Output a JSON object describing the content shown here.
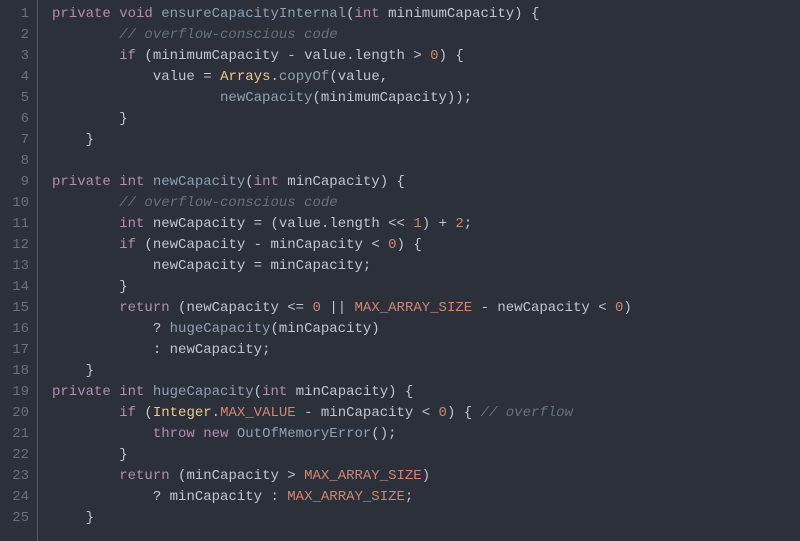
{
  "colors": {
    "background": "#2b303b",
    "gutter_border": "#4f5b66",
    "gutter_text": "#65737e",
    "default": "#c0c5ce",
    "keyword": "#b48ead",
    "function": "#8fa1b3",
    "number": "#d08770",
    "comment": "#65737e",
    "class": "#ebcb8b",
    "constant": "#d08770"
  },
  "lines": [
    {
      "num": "1",
      "tokens": [
        [
          "k",
          "private"
        ],
        [
          "p",
          " "
        ],
        [
          "t",
          "void"
        ],
        [
          "p",
          " "
        ],
        [
          "fn",
          "ensureCapacityInternal"
        ],
        [
          "p",
          "("
        ],
        [
          "t",
          "int"
        ],
        [
          "p",
          " "
        ],
        [
          "id",
          "minimumCapacity"
        ],
        [
          "p",
          ") {"
        ]
      ]
    },
    {
      "num": "2",
      "tokens": [
        [
          "p",
          "        "
        ],
        [
          "cm",
          "// overflow-conscious code"
        ]
      ]
    },
    {
      "num": "3",
      "tokens": [
        [
          "p",
          "        "
        ],
        [
          "k",
          "if"
        ],
        [
          "p",
          " ("
        ],
        [
          "id",
          "minimumCapacity"
        ],
        [
          "p",
          " "
        ],
        [
          "op",
          "-"
        ],
        [
          "p",
          " "
        ],
        [
          "id",
          "value"
        ],
        [
          "p",
          "."
        ],
        [
          "id",
          "length"
        ],
        [
          "p",
          " "
        ],
        [
          "op",
          ">"
        ],
        [
          "p",
          " "
        ],
        [
          "num",
          "0"
        ],
        [
          "p",
          ") {"
        ]
      ]
    },
    {
      "num": "4",
      "tokens": [
        [
          "p",
          "            "
        ],
        [
          "id",
          "value"
        ],
        [
          "p",
          " "
        ],
        [
          "op",
          "="
        ],
        [
          "p",
          " "
        ],
        [
          "cls",
          "Arrays"
        ],
        [
          "p",
          "."
        ],
        [
          "fn",
          "copyOf"
        ],
        [
          "p",
          "("
        ],
        [
          "id",
          "value"
        ],
        [
          "p",
          ","
        ]
      ]
    },
    {
      "num": "5",
      "tokens": [
        [
          "p",
          "                    "
        ],
        [
          "fn",
          "newCapacity"
        ],
        [
          "p",
          "("
        ],
        [
          "id",
          "minimumCapacity"
        ],
        [
          "p",
          "));"
        ]
      ]
    },
    {
      "num": "6",
      "tokens": [
        [
          "p",
          "        }"
        ]
      ]
    },
    {
      "num": "7",
      "tokens": [
        [
          "p",
          "    }"
        ]
      ]
    },
    {
      "num": "8",
      "tokens": [
        [
          "p",
          ""
        ]
      ]
    },
    {
      "num": "9",
      "tokens": [
        [
          "k",
          "private"
        ],
        [
          "p",
          " "
        ],
        [
          "t",
          "int"
        ],
        [
          "p",
          " "
        ],
        [
          "fn",
          "newCapacity"
        ],
        [
          "p",
          "("
        ],
        [
          "t",
          "int"
        ],
        [
          "p",
          " "
        ],
        [
          "id",
          "minCapacity"
        ],
        [
          "p",
          ") {"
        ]
      ]
    },
    {
      "num": "10",
      "tokens": [
        [
          "p",
          "        "
        ],
        [
          "cm",
          "// overflow-conscious code"
        ]
      ]
    },
    {
      "num": "11",
      "tokens": [
        [
          "p",
          "        "
        ],
        [
          "t",
          "int"
        ],
        [
          "p",
          " "
        ],
        [
          "id",
          "newCapacity"
        ],
        [
          "p",
          " "
        ],
        [
          "op",
          "="
        ],
        [
          "p",
          " ("
        ],
        [
          "id",
          "value"
        ],
        [
          "p",
          "."
        ],
        [
          "id",
          "length"
        ],
        [
          "p",
          " "
        ],
        [
          "op",
          "<<"
        ],
        [
          "p",
          " "
        ],
        [
          "num",
          "1"
        ],
        [
          "p",
          ") "
        ],
        [
          "op",
          "+"
        ],
        [
          "p",
          " "
        ],
        [
          "num",
          "2"
        ],
        [
          "p",
          ";"
        ]
      ]
    },
    {
      "num": "12",
      "tokens": [
        [
          "p",
          "        "
        ],
        [
          "k",
          "if"
        ],
        [
          "p",
          " ("
        ],
        [
          "id",
          "newCapacity"
        ],
        [
          "p",
          " "
        ],
        [
          "op",
          "-"
        ],
        [
          "p",
          " "
        ],
        [
          "id",
          "minCapacity"
        ],
        [
          "p",
          " "
        ],
        [
          "op",
          "<"
        ],
        [
          "p",
          " "
        ],
        [
          "num",
          "0"
        ],
        [
          "p",
          ") {"
        ]
      ]
    },
    {
      "num": "13",
      "tokens": [
        [
          "p",
          "            "
        ],
        [
          "id",
          "newCapacity"
        ],
        [
          "p",
          " "
        ],
        [
          "op",
          "="
        ],
        [
          "p",
          " "
        ],
        [
          "id",
          "minCapacity"
        ],
        [
          "p",
          ";"
        ]
      ]
    },
    {
      "num": "14",
      "tokens": [
        [
          "p",
          "        }"
        ]
      ]
    },
    {
      "num": "15",
      "tokens": [
        [
          "p",
          "        "
        ],
        [
          "k",
          "return"
        ],
        [
          "p",
          " ("
        ],
        [
          "id",
          "newCapacity"
        ],
        [
          "p",
          " "
        ],
        [
          "op",
          "<="
        ],
        [
          "p",
          " "
        ],
        [
          "num",
          "0"
        ],
        [
          "p",
          " "
        ],
        [
          "op",
          "||"
        ],
        [
          "p",
          " "
        ],
        [
          "con",
          "MAX_ARRAY_SIZE"
        ],
        [
          "p",
          " "
        ],
        [
          "op",
          "-"
        ],
        [
          "p",
          " "
        ],
        [
          "id",
          "newCapacity"
        ],
        [
          "p",
          " "
        ],
        [
          "op",
          "<"
        ],
        [
          "p",
          " "
        ],
        [
          "num",
          "0"
        ],
        [
          "p",
          ")"
        ]
      ]
    },
    {
      "num": "16",
      "tokens": [
        [
          "p",
          "            "
        ],
        [
          "op",
          "?"
        ],
        [
          "p",
          " "
        ],
        [
          "fn",
          "hugeCapacity"
        ],
        [
          "p",
          "("
        ],
        [
          "id",
          "minCapacity"
        ],
        [
          "p",
          ")"
        ]
      ]
    },
    {
      "num": "17",
      "tokens": [
        [
          "p",
          "            "
        ],
        [
          "op",
          ":"
        ],
        [
          "p",
          " "
        ],
        [
          "id",
          "newCapacity"
        ],
        [
          "p",
          ";"
        ]
      ]
    },
    {
      "num": "18",
      "tokens": [
        [
          "p",
          "    }"
        ]
      ]
    },
    {
      "num": "19",
      "tokens": [
        [
          "k",
          "private"
        ],
        [
          "p",
          " "
        ],
        [
          "t",
          "int"
        ],
        [
          "p",
          " "
        ],
        [
          "fn",
          "hugeCapacity"
        ],
        [
          "p",
          "("
        ],
        [
          "t",
          "int"
        ],
        [
          "p",
          " "
        ],
        [
          "id",
          "minCapacity"
        ],
        [
          "p",
          ") {"
        ]
      ]
    },
    {
      "num": "20",
      "tokens": [
        [
          "p",
          "        "
        ],
        [
          "k",
          "if"
        ],
        [
          "p",
          " ("
        ],
        [
          "cls",
          "Integer"
        ],
        [
          "p",
          "."
        ],
        [
          "con",
          "MAX_VALUE"
        ],
        [
          "p",
          " "
        ],
        [
          "op",
          "-"
        ],
        [
          "p",
          " "
        ],
        [
          "id",
          "minCapacity"
        ],
        [
          "p",
          " "
        ],
        [
          "op",
          "<"
        ],
        [
          "p",
          " "
        ],
        [
          "num",
          "0"
        ],
        [
          "p",
          ") { "
        ],
        [
          "cm",
          "// overflow"
        ]
      ]
    },
    {
      "num": "21",
      "tokens": [
        [
          "p",
          "            "
        ],
        [
          "k",
          "throw"
        ],
        [
          "p",
          " "
        ],
        [
          "k",
          "new"
        ],
        [
          "p",
          " "
        ],
        [
          "fn",
          "OutOfMemoryError"
        ],
        [
          "p",
          "();"
        ]
      ]
    },
    {
      "num": "22",
      "tokens": [
        [
          "p",
          "        }"
        ]
      ]
    },
    {
      "num": "23",
      "tokens": [
        [
          "p",
          "        "
        ],
        [
          "k",
          "return"
        ],
        [
          "p",
          " ("
        ],
        [
          "id",
          "minCapacity"
        ],
        [
          "p",
          " "
        ],
        [
          "op",
          ">"
        ],
        [
          "p",
          " "
        ],
        [
          "con",
          "MAX_ARRAY_SIZE"
        ],
        [
          "p",
          ")"
        ]
      ]
    },
    {
      "num": "24",
      "tokens": [
        [
          "p",
          "            "
        ],
        [
          "op",
          "?"
        ],
        [
          "p",
          " "
        ],
        [
          "id",
          "minCapacity"
        ],
        [
          "p",
          " "
        ],
        [
          "op",
          ":"
        ],
        [
          "p",
          " "
        ],
        [
          "con",
          "MAX_ARRAY_SIZE"
        ],
        [
          "p",
          ";"
        ]
      ]
    },
    {
      "num": "25",
      "tokens": [
        [
          "p",
          "    }"
        ]
      ]
    }
  ]
}
